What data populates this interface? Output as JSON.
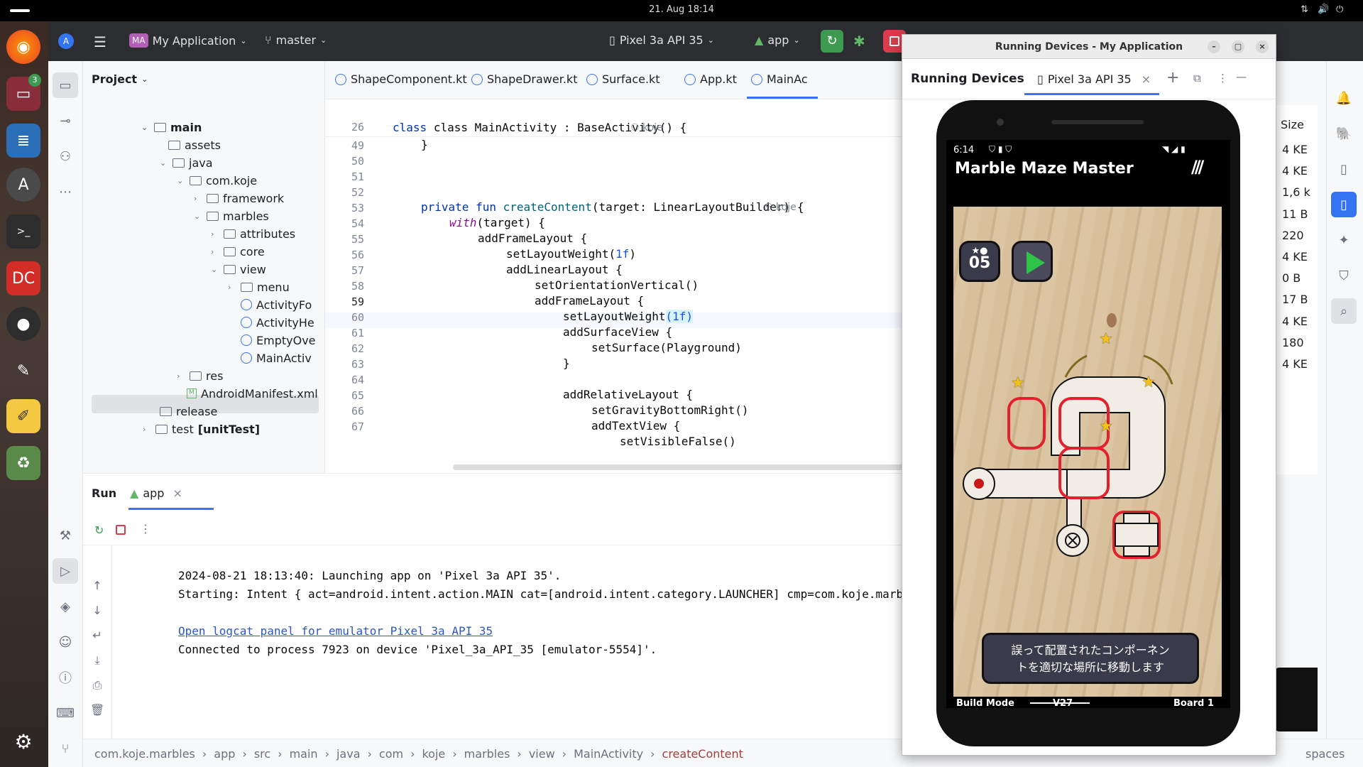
{
  "system": {
    "clock": "21. Aug  18:14",
    "net_icon": "network-icon",
    "vol_icon": "volume-icon",
    "power_icon": "power-icon"
  },
  "ide": {
    "avatar": "MA",
    "project_name": "My Application",
    "branch": "master",
    "device": "Pixel 3a API 35",
    "run_config": "app",
    "project_panel_title": "Project",
    "tree": [
      {
        "label": "main",
        "bold": true
      },
      {
        "label": "assets"
      },
      {
        "label": "java"
      },
      {
        "label": "com.koje"
      },
      {
        "label": "framework"
      },
      {
        "label": "marbles"
      },
      {
        "label": "attributes"
      },
      {
        "label": "core"
      },
      {
        "label": "view"
      },
      {
        "label": "menu"
      },
      {
        "label": "ActivityFo"
      },
      {
        "label": "ActivityHe"
      },
      {
        "label": "EmptyOve"
      },
      {
        "label": "MainActiv"
      },
      {
        "label": "res"
      },
      {
        "label": "AndroidManifest.xml"
      },
      {
        "label": "release"
      },
      {
        "label": "test",
        "suffix": "[unitTest]"
      }
    ],
    "tabs": [
      "ShapeComponent.kt",
      "ShapeDrawer.kt",
      "Surface.kt",
      "App.kt",
      "MainAc"
    ],
    "sticky_line": "26",
    "sticky_code": "class MainActivity : BaseActivity() {",
    "author_hint": "koje",
    "lines": [
      "49",
      "50",
      "51",
      "52",
      "53",
      "54",
      "55",
      "56",
      "57",
      "58",
      "59",
      "60",
      "61",
      "62",
      "63",
      "64",
      "65",
      "66",
      "67"
    ],
    "code": {
      "l49": "}",
      "l52_kw": "private fun ",
      "l52_fn": "createContent",
      "l52_rest": "(target: LinearLayoutBuilder) {",
      "l53_it": "with",
      "l53_rest": "(target) {",
      "l54": "addFrameLayout {",
      "l55a": "setLayoutWeight(",
      "l55n": "1f",
      "l55b": ")",
      "l56": "addLinearLayout {",
      "l57": "setOrientationVertical()",
      "l58": "addFrameLayout {",
      "l59a": "setLayoutWeight",
      "l59n": "(1f)",
      "l60": "addSurfaceView {",
      "l61": "setSurface(Playground)",
      "l62": "}",
      "l64": "addRelativeLayout {",
      "l65": "setGravityBottomRight()",
      "l66": "addTextView {",
      "l67": "setVisibleFalse()"
    },
    "run_panel": {
      "title": "Run",
      "tab": "app"
    },
    "console": [
      "2024-08-21 18:13:40: Launching app on 'Pixel 3a API 35'.",
      "Starting: Intent { act=android.intent.action.MAIN cat=[android.intent.category.LAUNCHER] cmp=com.koje.marbles",
      "Open logcat panel for emulator Pixel 3a API 35",
      "Connected to process 7923 on device 'Pixel_3a_API_35 [emulator-5554]'."
    ],
    "breadcrumb": [
      "com.koje.marbles",
      "app",
      "src",
      "main",
      "java",
      "com",
      "koje",
      "marbles",
      "view",
      "MainActivity",
      "createContent"
    ],
    "status_right": "spaces",
    "size_column": {
      "header": "Size",
      "values": [
        "4 KE",
        "4 KE",
        "1,6 k",
        "11 B",
        "220",
        "4 KE",
        "0 B",
        "17 B",
        "4 KE",
        "180",
        "4 KE"
      ]
    }
  },
  "running_devices": {
    "window_title": "Running Devices - My Application",
    "panel_title": "Running Devices",
    "device_tab": "Pixel 3a API 35",
    "phone": {
      "time": "6:14",
      "app_title": "Marble Maze Master",
      "level": "05",
      "hint_text_1": "誤って配置されたコンポーネン",
      "hint_text_2": "トを適切な場所に移動します",
      "footer_left": "Build Mode",
      "footer_mid": "V27",
      "footer_right": "Board 1"
    }
  },
  "colors": {
    "accent": "#3574f0",
    "run_green": "#3d9a50",
    "stop_red": "#db3b4b",
    "maze_red": "#e0222f"
  }
}
